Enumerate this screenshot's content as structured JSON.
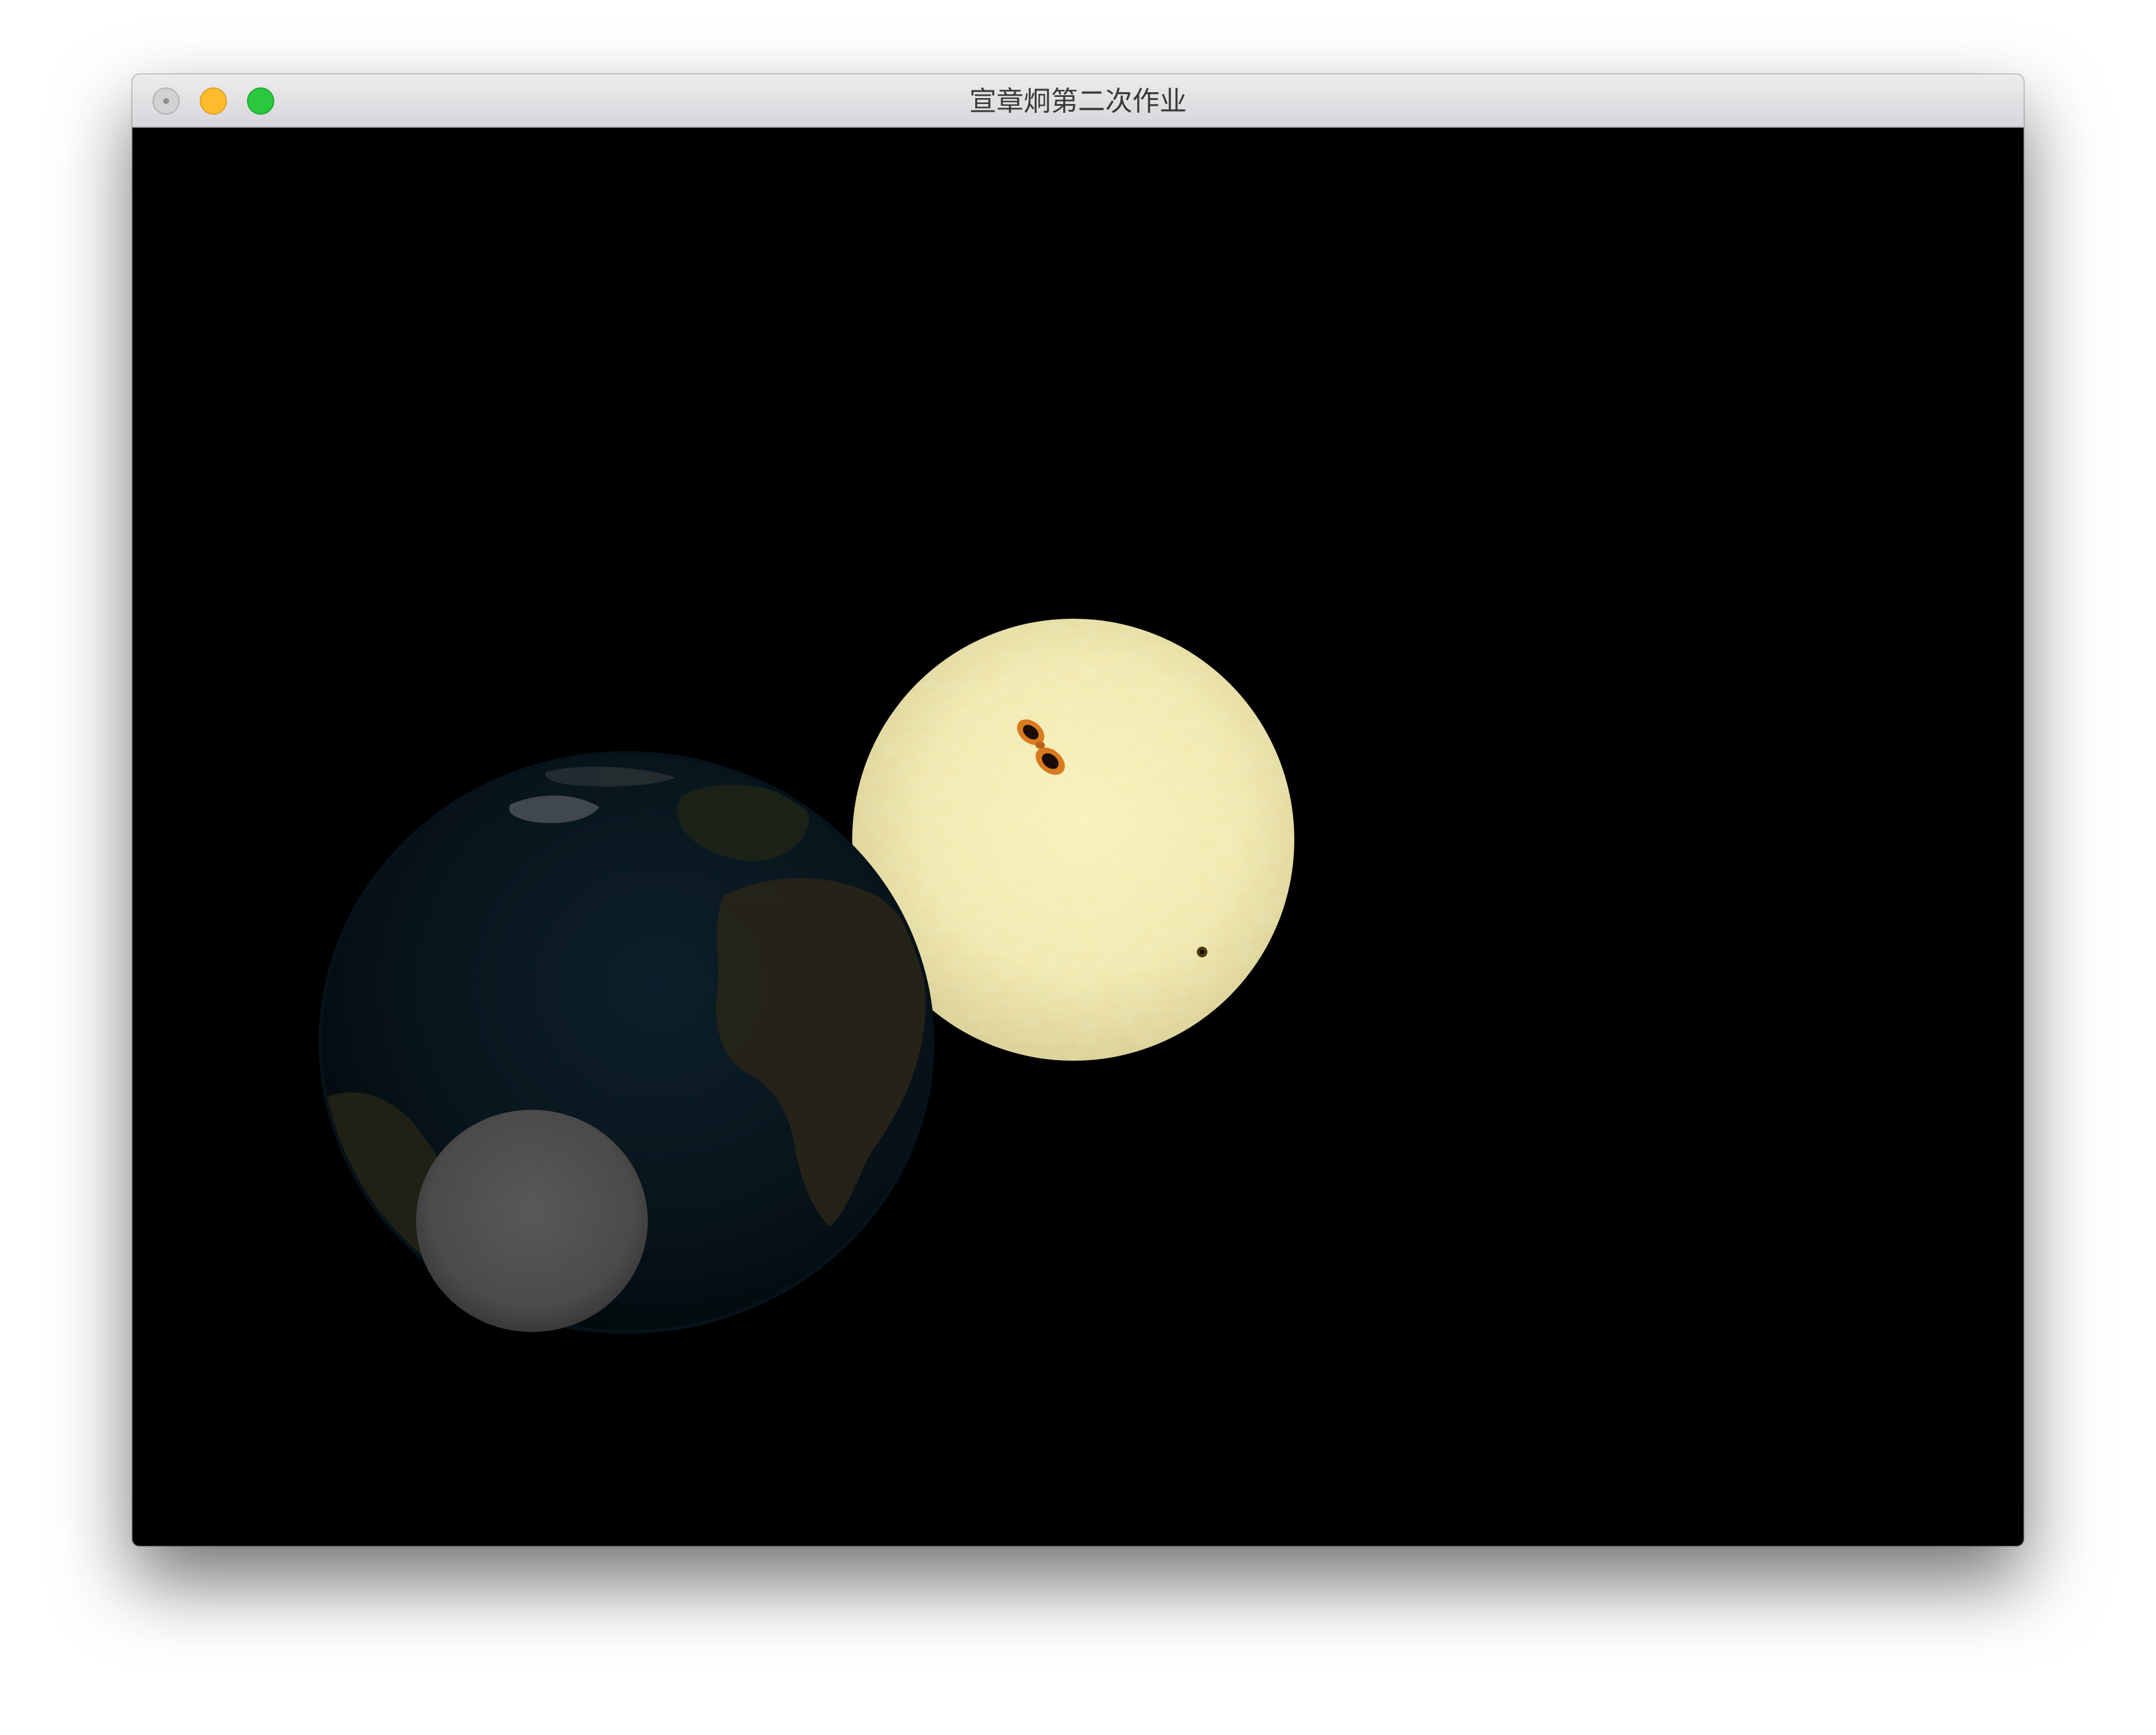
{
  "window": {
    "title": "宣章炯第二次作业",
    "buttons": {
      "close": "close-button",
      "minimize": "minimize-button",
      "maximize": "maximize-button"
    }
  },
  "scene": {
    "background": "#000000",
    "bodies": [
      {
        "name": "sun",
        "texture": "yellow-sunspot",
        "color": "#f2ecb0"
      },
      {
        "name": "earth",
        "texture": "dark-earth",
        "color": "#0b1a22"
      },
      {
        "name": "moon",
        "texture": "grey-noise",
        "color": "#3a3a3a"
      }
    ]
  },
  "colors": {
    "close": "#d2d1d3",
    "minimize": "#fdbb2d",
    "maximize": "#2ac83f"
  }
}
